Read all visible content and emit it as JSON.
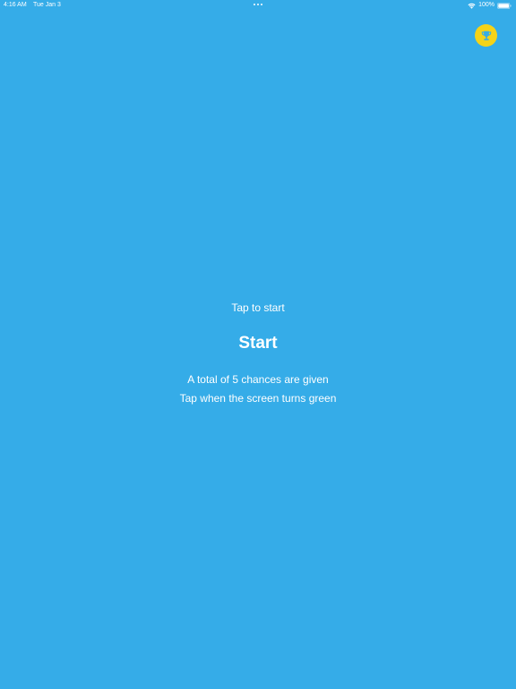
{
  "status_bar": {
    "time": "4:16 AM",
    "date": "Tue Jan 3",
    "battery": "100%"
  },
  "icons": {
    "wifi": "wifi-icon",
    "battery": "battery-icon",
    "trophy": "trophy-icon"
  },
  "colors": {
    "background": "#35ACE8",
    "trophy_badge": "#F5D318",
    "trophy": "#35ACE8",
    "text": "#FFFFFF"
  },
  "main": {
    "prompt": "Tap to start",
    "title": "Start",
    "info_1": "A total of 5 chances are given",
    "info_2": "Tap when the screen turns green"
  }
}
